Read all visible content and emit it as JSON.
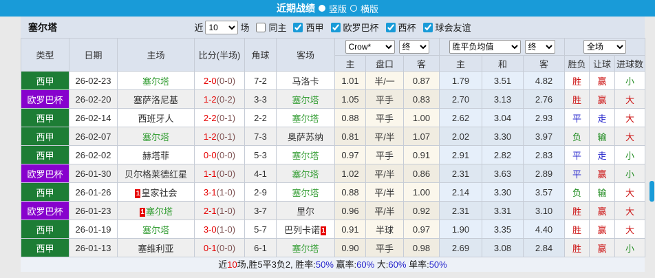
{
  "titlebar": {
    "title": "近期战绩",
    "radio_vertical": "竖版",
    "radio_horizontal": "横版"
  },
  "filter": {
    "team": "塞尔塔",
    "near_label": "近",
    "match_count": "10",
    "games_label": "场",
    "same_home": "同主",
    "leagues": [
      "西甲",
      "欧罗巴杯",
      "西杯",
      "球会友谊"
    ]
  },
  "table": {
    "headers": {
      "type": "类型",
      "date": "日期",
      "home": "主场",
      "score": "比分(半场)",
      "corner": "角球",
      "away": "客场",
      "sub": [
        "主",
        "盘口",
        "客",
        "主",
        "和",
        "客",
        "胜负",
        "让球",
        "进球数"
      ]
    },
    "dropdowns": {
      "crow": "Crow*",
      "final": "终",
      "avg": "胜平负均值",
      "scope": "全场"
    },
    "red_card_label": "1",
    "rows": [
      {
        "league": "西甲",
        "lc": "g",
        "date": "26-02-23",
        "home": {
          "name": "塞尔塔",
          "self": true,
          "card": null
        },
        "score": "2-0",
        "half": "(0-0)",
        "corner": "7-2",
        "away": {
          "name": "马洛卡",
          "self": false,
          "card": null
        },
        "asia": [
          "1.01",
          "半/一",
          "0.87"
        ],
        "euro": [
          "1.79",
          "3.51",
          "4.82"
        ],
        "res": {
          "t": "胜",
          "c": "r"
        },
        "hres": {
          "t": "赢",
          "c": "r"
        },
        "goal": {
          "t": "小",
          "c": "g"
        }
      },
      {
        "league": "欧罗巴杯",
        "lc": "p",
        "date": "26-02-20",
        "home": {
          "name": "塞萨洛尼基",
          "self": false,
          "card": null
        },
        "score": "1-2",
        "half": "(0-2)",
        "corner": "3-3",
        "away": {
          "name": "塞尔塔",
          "self": true,
          "card": null
        },
        "asia": [
          "1.05",
          "平手",
          "0.83"
        ],
        "euro": [
          "2.70",
          "3.13",
          "2.76"
        ],
        "res": {
          "t": "胜",
          "c": "r"
        },
        "hres": {
          "t": "赢",
          "c": "r"
        },
        "goal": {
          "t": "大",
          "c": "r"
        }
      },
      {
        "league": "西甲",
        "lc": "g",
        "date": "26-02-14",
        "home": {
          "name": "西班牙人",
          "self": false,
          "card": null
        },
        "score": "2-2",
        "half": "(0-1)",
        "corner": "2-2",
        "away": {
          "name": "塞尔塔",
          "self": true,
          "card": null
        },
        "asia": [
          "0.88",
          "平手",
          "1.00"
        ],
        "euro": [
          "2.62",
          "3.04",
          "2.93"
        ],
        "res": {
          "t": "平",
          "c": "b"
        },
        "hres": {
          "t": "走",
          "c": "b"
        },
        "goal": {
          "t": "大",
          "c": "r"
        }
      },
      {
        "league": "西甲",
        "lc": "g",
        "date": "26-02-07",
        "home": {
          "name": "塞尔塔",
          "self": true,
          "card": null
        },
        "score": "1-2",
        "half": "(0-1)",
        "corner": "7-3",
        "away": {
          "name": "奥萨苏纳",
          "self": false,
          "card": null
        },
        "asia": [
          "0.81",
          "平/半",
          "1.07"
        ],
        "euro": [
          "2.02",
          "3.30",
          "3.97"
        ],
        "res": {
          "t": "负",
          "c": "g"
        },
        "hres": {
          "t": "输",
          "c": "g"
        },
        "goal": {
          "t": "大",
          "c": "r"
        }
      },
      {
        "league": "西甲",
        "lc": "g",
        "date": "26-02-02",
        "home": {
          "name": "赫塔菲",
          "self": false,
          "card": null
        },
        "score": "0-0",
        "half": "(0-0)",
        "corner": "5-3",
        "away": {
          "name": "塞尔塔",
          "self": true,
          "card": null
        },
        "asia": [
          "0.97",
          "平手",
          "0.91"
        ],
        "euro": [
          "2.91",
          "2.82",
          "2.83"
        ],
        "res": {
          "t": "平",
          "c": "b"
        },
        "hres": {
          "t": "走",
          "c": "b"
        },
        "goal": {
          "t": "小",
          "c": "g"
        }
      },
      {
        "league": "欧罗巴杯",
        "lc": "p",
        "date": "26-01-30",
        "home": {
          "name": "贝尔格莱德红星",
          "self": false,
          "card": null
        },
        "score": "1-1",
        "half": "(0-0)",
        "corner": "4-1",
        "away": {
          "name": "塞尔塔",
          "self": true,
          "card": null
        },
        "asia": [
          "1.02",
          "平/半",
          "0.86"
        ],
        "euro": [
          "2.31",
          "3.63",
          "2.89"
        ],
        "res": {
          "t": "平",
          "c": "b"
        },
        "hres": {
          "t": "赢",
          "c": "r"
        },
        "goal": {
          "t": "小",
          "c": "g"
        }
      },
      {
        "league": "西甲",
        "lc": "g",
        "date": "26-01-26",
        "home": {
          "name": "皇家社会",
          "self": false,
          "card": "1"
        },
        "score": "3-1",
        "half": "(1-0)",
        "corner": "2-9",
        "away": {
          "name": "塞尔塔",
          "self": true,
          "card": null
        },
        "asia": [
          "0.88",
          "平/半",
          "1.00"
        ],
        "euro": [
          "2.14",
          "3.30",
          "3.57"
        ],
        "res": {
          "t": "负",
          "c": "g"
        },
        "hres": {
          "t": "输",
          "c": "g"
        },
        "goal": {
          "t": "大",
          "c": "r"
        }
      },
      {
        "league": "欧罗巴杯",
        "lc": "p",
        "date": "26-01-23",
        "home": {
          "name": "塞尔塔",
          "self": true,
          "card": "1"
        },
        "score": "2-1",
        "half": "(1-0)",
        "corner": "3-7",
        "away": {
          "name": "里尔",
          "self": false,
          "card": null
        },
        "asia": [
          "0.96",
          "平/半",
          "0.92"
        ],
        "euro": [
          "2.31",
          "3.31",
          "3.10"
        ],
        "res": {
          "t": "胜",
          "c": "r"
        },
        "hres": {
          "t": "赢",
          "c": "r"
        },
        "goal": {
          "t": "大",
          "c": "r"
        }
      },
      {
        "league": "西甲",
        "lc": "g",
        "date": "26-01-19",
        "home": {
          "name": "塞尔塔",
          "self": true,
          "card": null
        },
        "score": "3-0",
        "half": "(1-0)",
        "corner": "5-7",
        "away": {
          "name": "巴列卡诺",
          "self": false,
          "card": "1"
        },
        "asia": [
          "0.91",
          "半球",
          "0.97"
        ],
        "euro": [
          "1.90",
          "3.35",
          "4.40"
        ],
        "res": {
          "t": "胜",
          "c": "r"
        },
        "hres": {
          "t": "赢",
          "c": "r"
        },
        "goal": {
          "t": "大",
          "c": "r"
        }
      },
      {
        "league": "西甲",
        "lc": "g",
        "date": "26-01-13",
        "home": {
          "name": "塞维利亚",
          "self": false,
          "card": null
        },
        "score": "0-1",
        "half": "(0-0)",
        "corner": "6-1",
        "away": {
          "name": "塞尔塔",
          "self": true,
          "card": null
        },
        "asia": [
          "0.90",
          "平手",
          "0.98"
        ],
        "euro": [
          "2.69",
          "3.08",
          "2.84"
        ],
        "res": {
          "t": "胜",
          "c": "r"
        },
        "hres": {
          "t": "赢",
          "c": "r"
        },
        "goal": {
          "t": "小",
          "c": "g"
        }
      }
    ]
  },
  "summary": {
    "parts": [
      {
        "t": "近",
        "c": "k"
      },
      {
        "t": "10",
        "c": "r"
      },
      {
        "t": "场,胜5平3负2, 胜率:",
        "c": "k"
      },
      {
        "t": "50%",
        "c": "b"
      },
      {
        "t": " 赢率:",
        "c": "k"
      },
      {
        "t": "60%",
        "c": "b"
      },
      {
        "t": " 大:",
        "c": "k"
      },
      {
        "t": "60%",
        "c": "b"
      },
      {
        "t": " 单率:",
        "c": "k"
      },
      {
        "t": "50%",
        "c": "b"
      }
    ]
  },
  "colors": {
    "topbar_blue": "#199bd8",
    "league_green": "#1d7d35",
    "league_purple": "#8702cd",
    "win_red": "#cc1111",
    "draw_blue": "#2525cc",
    "lose_green": "#1f8b1f",
    "score_red": "#e60000",
    "self_team_green": "#3aa03a"
  }
}
